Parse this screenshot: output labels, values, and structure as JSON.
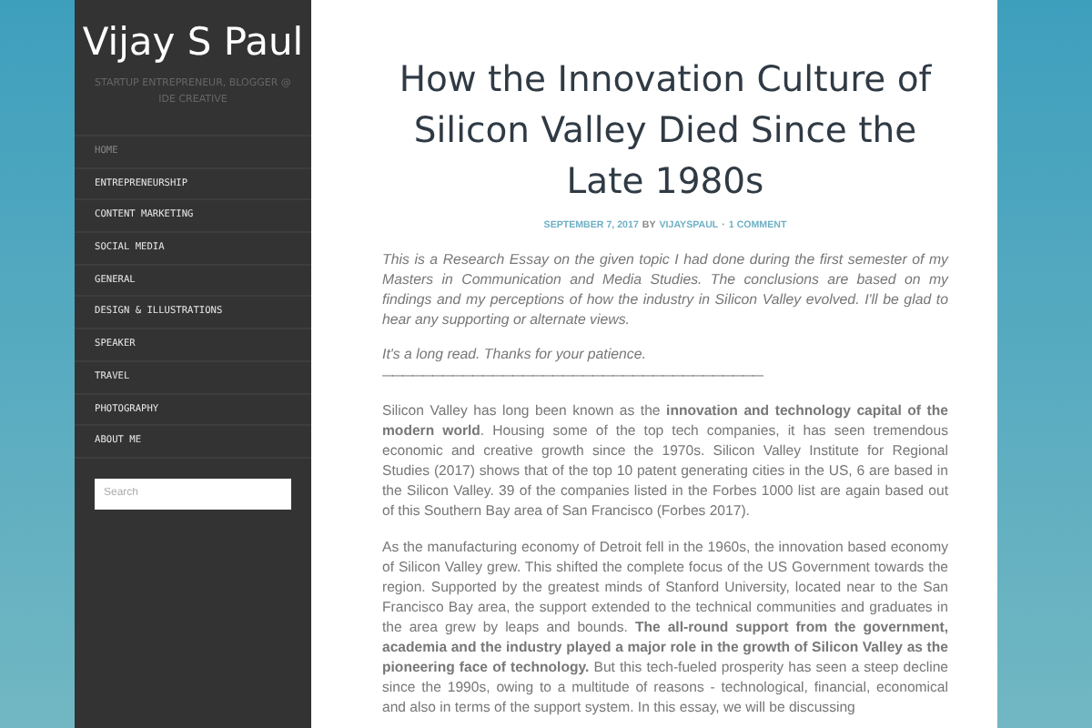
{
  "site": {
    "title": "Vijay S Paul",
    "tagline": "STARTUP ENTREPRENEUR, BLOGGER @ IDE CREATIVE"
  },
  "menu": [
    {
      "label": "HOME",
      "selected": true
    },
    {
      "label": "ENTREPRENEURSHIP",
      "selected": false
    },
    {
      "label": "CONTENT MARKETING",
      "selected": false
    },
    {
      "label": "SOCIAL MEDIA",
      "selected": false
    },
    {
      "label": "GENERAL",
      "selected": false
    },
    {
      "label": "DESIGN & ILLUSTRATIONS",
      "selected": false
    },
    {
      "label": "SPEAKER",
      "selected": false
    },
    {
      "label": "TRAVEL",
      "selected": false
    },
    {
      "label": "PHOTOGRAPHY",
      "selected": false
    },
    {
      "label": "ABOUT ME",
      "selected": false
    }
  ],
  "search": {
    "placeholder": "Search"
  },
  "post": {
    "title": "How the Innovation Culture of Silicon Valley Died Since the Late 1980s",
    "date": "SEPTEMBER 7, 2017",
    "by": "BY",
    "author": "VIJAYSPAUL",
    "separator": "·",
    "comments": "1 COMMENT",
    "intro": [
      "This is a Research Essay on the given topic I had done during the first semester of my Masters in Communication and Media Studies. The conclusions are based on my findings and my perceptions of how the industry in Silicon Valley evolved. I'll be glad to hear any supporting or alternate views.",
      "It's a long read. Thanks for your patience."
    ],
    "divider": "——————————————————————————————————————",
    "paragraphs": [
      "Silicon Valley has long been known as the **innovation and technology capital of the modern world**. Housing some of the top tech companies, it has seen tremendous economic and creative growth since the 1970s. Silicon Valley Institute for Regional Studies (2017) shows that of the top 10 patent generating cities in the US, 6 are based in the Silicon Valley. 39 of the companies listed in the Forbes 1000 list are again based out of this Southern Bay area of San Francisco (Forbes 2017).",
      "As the manufacturing economy of Detroit fell in the 1960s, the innovation based economy of Silicon Valley grew. This shifted the complete focus of the US Government towards the region. Supported by the greatest minds of Stanford University, located near to the San Francisco Bay area, the support extended to the technical communities and graduates in the area grew by leaps and bounds. **The all-round support from the government, academia and the industry played a major role in the growth of Silicon Valley as the pioneering face of technology.** But this tech-fueled prosperity has seen a steep decline since the 1990s, owing to a multitude of reasons - technological, financial, economical and also in terms of the support system. In this essay, we will be discussing"
    ]
  }
}
